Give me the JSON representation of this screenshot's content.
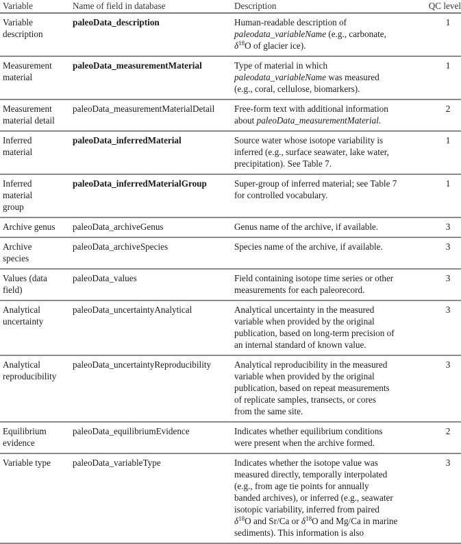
{
  "table": {
    "headers": [
      "Variable",
      "Name of field in database",
      "Description",
      "QC level"
    ],
    "rows": [
      {
        "variable": [
          "Variable",
          "description"
        ],
        "field": "paleoData_description",
        "field_bold": true,
        "description": [
          [
            {
              "t": "Human-readable description of"
            }
          ],
          [
            {
              "t": "paleodata_variableName",
              "i": true
            },
            {
              "t": " (e.g., carbonate,"
            }
          ],
          [
            {
              "t": "δ",
              "d": true
            },
            {
              "t": "18",
              "sup": true
            },
            {
              "t": "O of glacier ice)."
            }
          ]
        ],
        "qc": "1"
      },
      {
        "variable": [
          "Measurement",
          "material"
        ],
        "field": "paleoData_measurementMaterial",
        "field_bold": true,
        "description": [
          [
            {
              "t": "Type of material in which"
            }
          ],
          [
            {
              "t": "paleodata_variableName",
              "i": true
            },
            {
              "t": " was measured"
            }
          ],
          [
            {
              "t": "(e.g., coral, cellulose, biomarkers)."
            }
          ]
        ],
        "qc": "1"
      },
      {
        "variable": [
          "Measurement",
          "material detail"
        ],
        "field": "paleoData_measurementMaterialDetail",
        "field_bold": false,
        "description": [
          [
            {
              "t": "Free-form text with additional information"
            }
          ],
          [
            {
              "t": "about "
            },
            {
              "t": "paleoData_measurementMaterial.",
              "i": true
            }
          ]
        ],
        "qc": "2"
      },
      {
        "variable": [
          "Inferred",
          "material"
        ],
        "field": "paleoData_inferredMaterial",
        "field_bold": true,
        "description": [
          [
            {
              "t": "Source water whose isotope variability is"
            }
          ],
          [
            {
              "t": "inferred (e.g., surface seawater, lake water,"
            }
          ],
          [
            {
              "t": "precipitation). See Table 7."
            }
          ]
        ],
        "qc": "1"
      },
      {
        "variable": [
          "Inferred",
          "material",
          "group"
        ],
        "field": "paleoData_inferredMaterialGroup",
        "field_bold": true,
        "description": [
          [
            {
              "t": "Super-group of inferred material; see Table 7"
            }
          ],
          [
            {
              "t": "for controlled vocabulary."
            }
          ]
        ],
        "qc": "1"
      },
      {
        "variable": [
          "Archive genus"
        ],
        "field": "paleoData_archiveGenus",
        "field_bold": false,
        "description": [
          [
            {
              "t": "Genus name of the archive, if available."
            }
          ]
        ],
        "qc": "3"
      },
      {
        "variable": [
          "Archive",
          "species"
        ],
        "field": "paleoData_archiveSpecies",
        "field_bold": false,
        "description": [
          [
            {
              "t": "Species name of the archive, if available."
            }
          ]
        ],
        "qc": "3"
      },
      {
        "variable": [
          "Values (data",
          "field)"
        ],
        "field": "paleoData_values",
        "field_bold": false,
        "description": [
          [
            {
              "t": "Field containing isotope time series or other"
            }
          ],
          [
            {
              "t": "measurements for each paleorecord."
            }
          ]
        ],
        "qc": "3"
      },
      {
        "variable": [
          "Analytical",
          "uncertainty"
        ],
        "field": "paleoData_uncertaintyAnalytical",
        "field_bold": false,
        "description": [
          [
            {
              "t": "Analytical uncertainty in the measured"
            }
          ],
          [
            {
              "t": "variable when provided by the original"
            }
          ],
          [
            {
              "t": "publication, based on long-term precision of"
            }
          ],
          [
            {
              "t": "an internal standard of known value."
            }
          ]
        ],
        "qc": "3"
      },
      {
        "variable": [
          "Analytical",
          "reproducibility"
        ],
        "field": "paleoData_uncertaintyReproducibility",
        "field_bold": false,
        "description": [
          [
            {
              "t": "Analytical reproducibility in the measured"
            }
          ],
          [
            {
              "t": "variable when provided by the original"
            }
          ],
          [
            {
              "t": "publication, based on repeat measurements"
            }
          ],
          [
            {
              "t": "of replicate samples, transects, or cores"
            }
          ],
          [
            {
              "t": "from the same site."
            }
          ]
        ],
        "qc": "3"
      },
      {
        "variable": [
          "Equilibrium",
          "evidence"
        ],
        "field": "paleoData_equilibriumEvidence",
        "field_bold": false,
        "description": [
          [
            {
              "t": "Indicates whether equilibrium conditions"
            }
          ],
          [
            {
              "t": "were present when the archive formed."
            }
          ]
        ],
        "qc": "2"
      },
      {
        "variable": [
          "Variable type"
        ],
        "field": "paleoData_variableType",
        "field_bold": false,
        "description": [
          [
            {
              "t": "Indicates whether the isotope value was"
            }
          ],
          [
            {
              "t": "measured directly, temporally interpolated"
            }
          ],
          [
            {
              "t": "(e.g., from age tie points for annually"
            }
          ],
          [
            {
              "t": "banded archives), or inferred (e.g., seawater"
            }
          ],
          [
            {
              "t": "isotopic variability, inferred from paired"
            }
          ],
          [
            {
              "t": "δ",
              "d": true
            },
            {
              "t": "18",
              "sup": true
            },
            {
              "t": "O and Sr/Ca or "
            },
            {
              "t": "δ",
              "d": true
            },
            {
              "t": "18",
              "sup": true
            },
            {
              "t": "O and Mg/Ca in marine"
            }
          ],
          [
            {
              "t": "sediments). This information is also"
            }
          ]
        ],
        "qc": "3"
      }
    ]
  }
}
